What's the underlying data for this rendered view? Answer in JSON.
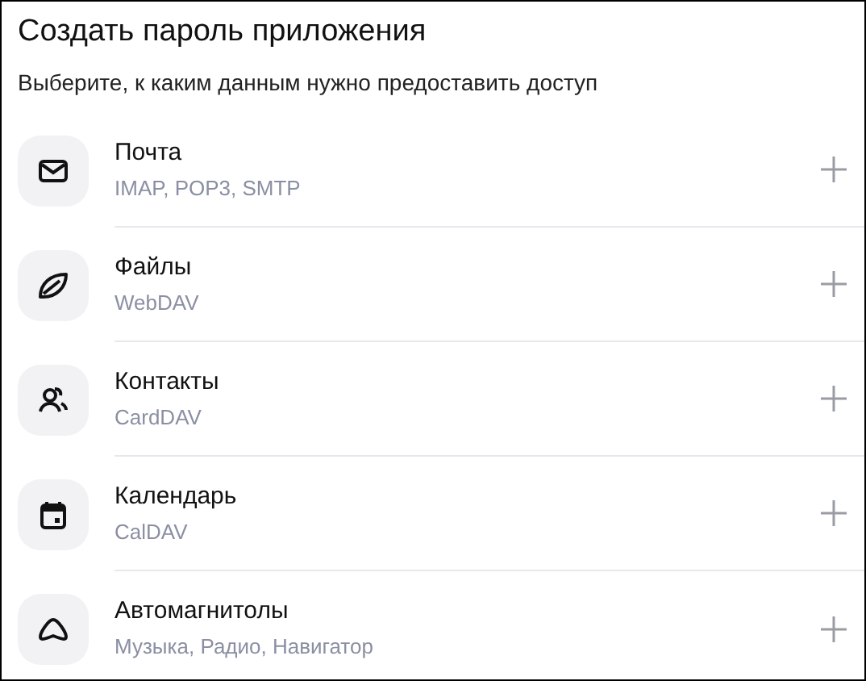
{
  "title": "Создать пароль приложения",
  "subtitle": "Выберите, к каким данным нужно предоставить доступ",
  "items": [
    {
      "kind": "mail",
      "name": "Почта",
      "protocols": "IMAP, POP3, SMTP"
    },
    {
      "kind": "files",
      "name": "Файлы",
      "protocols": "WebDAV"
    },
    {
      "kind": "contacts",
      "name": "Контакты",
      "protocols": "CardDAV"
    },
    {
      "kind": "calendar",
      "name": "Календарь",
      "protocols": "CalDAV"
    },
    {
      "kind": "car",
      "name": "Автомагнитолы",
      "protocols": "Музыка, Радио, Навигатор"
    }
  ]
}
